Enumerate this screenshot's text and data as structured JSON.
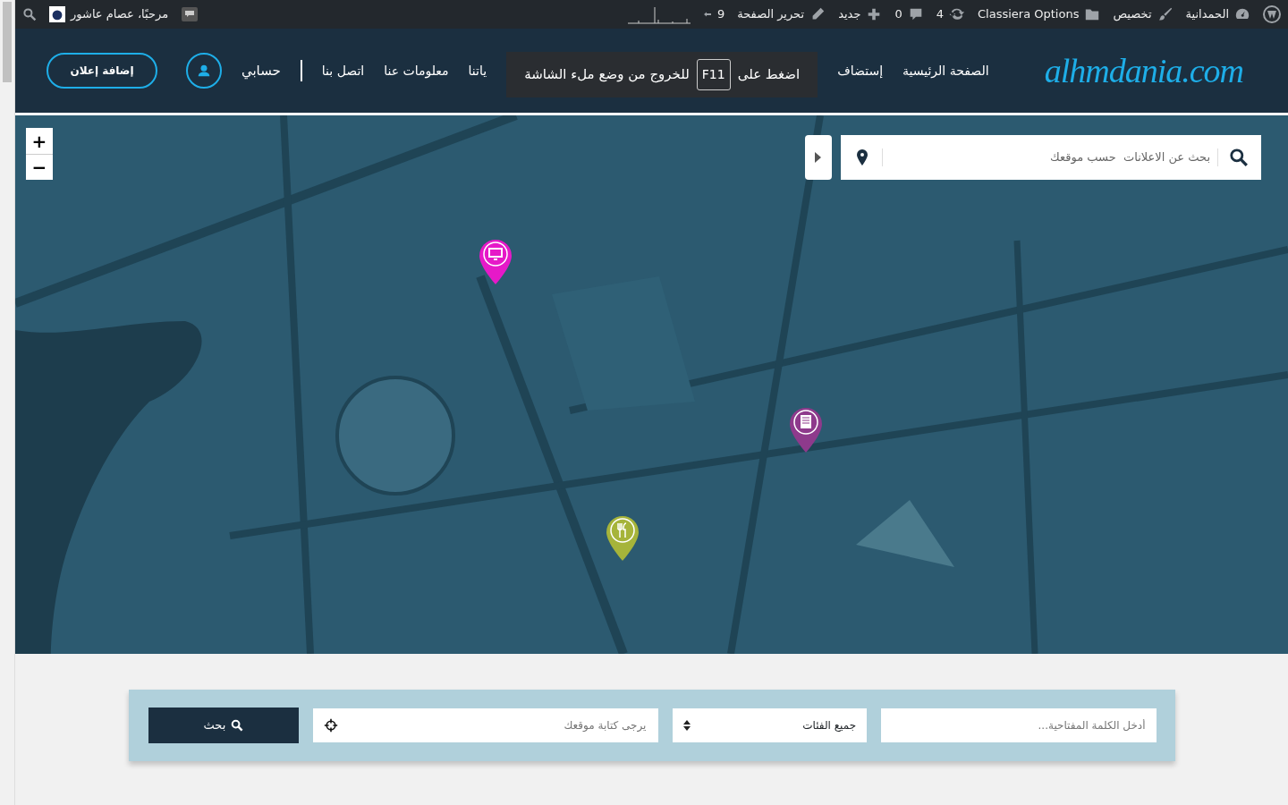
{
  "admin_bar": {
    "right_items": [
      {
        "label": "الحمدانية"
      },
      {
        "label": "تخصيص"
      },
      {
        "label": "Classiera Options"
      },
      {
        "label": "4"
      },
      {
        "label": "0"
      },
      {
        "label": "جديد"
      },
      {
        "label": "تحرير الصفحة"
      },
      {
        "label": "9"
      }
    ],
    "greeting": "مرحبًا، عصام عاشور"
  },
  "header": {
    "logo": "alhmdania.com",
    "nav": [
      {
        "label": "الصفحة الرئيسية"
      },
      {
        "label": "إستضاف"
      },
      {
        "label": "ياتنا"
      },
      {
        "label": "معلومات عنا"
      },
      {
        "label": "اتصل بنا"
      }
    ],
    "fullscreen_notice": {
      "before": "اضغط على",
      "key": "F11",
      "after": "للخروج من وضع ملء الشاشة"
    },
    "account": "حسابي",
    "post_button": "إضافة إعلان"
  },
  "map": {
    "search_placeholder": "بحث عن الاعلانات  حسب موقعك",
    "zoom_in": "+",
    "zoom_out": "−",
    "pins": [
      {
        "color": "#e619c8"
      },
      {
        "color": "#8e3a8c"
      },
      {
        "color": "#a6b43a"
      }
    ]
  },
  "search_form": {
    "keyword_placeholder": "أدخل الكلمة المفتاحية...",
    "category": "جميع الفئات",
    "location_placeholder": "يرجى كتابة موقعك",
    "button": "بحث"
  }
}
